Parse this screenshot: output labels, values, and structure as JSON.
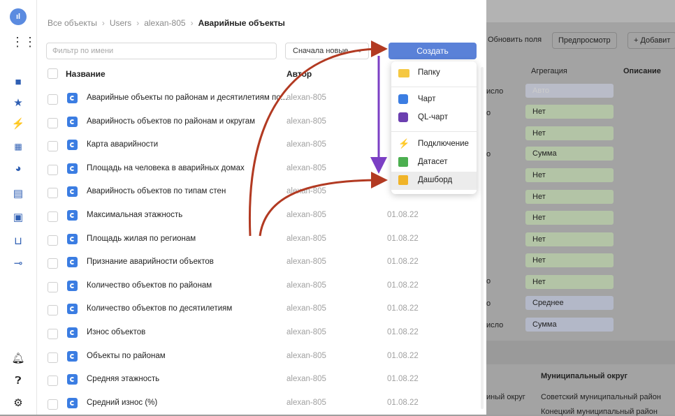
{
  "breadcrumb": {
    "items": [
      "Все объекты",
      "Users",
      "alexan-805"
    ],
    "current": "Аварийные объекты"
  },
  "filter": {
    "placeholder": "Фильтр по имени"
  },
  "sort": {
    "value": "Сначала новые"
  },
  "create_button": {
    "label": "Создать"
  },
  "table": {
    "columns": {
      "name": "Название",
      "author": "Автор"
    },
    "rows": [
      {
        "name": "Аварийные объекты по районам и десятилетиям по...",
        "author": "alexan-805",
        "date": ""
      },
      {
        "name": "Аварийность объектов по районам и округам",
        "author": "alexan-805",
        "date": ""
      },
      {
        "name": "Карта аварийности",
        "author": "alexan-805",
        "date": ""
      },
      {
        "name": "Площадь на человека в аварийных домах",
        "author": "alexan-805",
        "date": ""
      },
      {
        "name": "Аварийность объектов по типам стен",
        "author": "alexan-805",
        "date": ""
      },
      {
        "name": "Максимальная этажность",
        "author": "alexan-805",
        "date": "01.08.22"
      },
      {
        "name": "Площадь жилая по регионам",
        "author": "alexan-805",
        "date": "01.08.22"
      },
      {
        "name": "Признание аварийности объектов",
        "author": "alexan-805",
        "date": "01.08.22"
      },
      {
        "name": "Количество объектов по районам",
        "author": "alexan-805",
        "date": "01.08.22"
      },
      {
        "name": "Количество объектов по десятилетиям",
        "author": "alexan-805",
        "date": "01.08.22"
      },
      {
        "name": "Износ объектов",
        "author": "alexan-805",
        "date": "01.08.22"
      },
      {
        "name": "Объекты по районам",
        "author": "alexan-805",
        "date": "01.08.22"
      },
      {
        "name": "Средняя этажность",
        "author": "alexan-805",
        "date": "01.08.22"
      },
      {
        "name": "Средний износ (%)",
        "author": "alexan-805",
        "date": "01.08.22"
      }
    ]
  },
  "create_menu": {
    "items": [
      {
        "label": "Папку",
        "icon": "folder-icon",
        "color": "#f5c842"
      },
      {
        "label": "Чарт",
        "icon": "chart-icon",
        "color": "#3b7de2"
      },
      {
        "label": "QL-чарт",
        "icon": "ql-chart-icon",
        "color": "#6b3fb0"
      },
      {
        "label": "Подключение",
        "icon": "lightning-icon",
        "color": "#7b4bd6"
      },
      {
        "label": "Датасет",
        "icon": "dataset-icon",
        "color": "#4caf50"
      },
      {
        "label": "Дашборд",
        "icon": "dashboard-icon",
        "color": "#f0b429"
      }
    ]
  },
  "background": {
    "buttons": [
      "Обновить поля",
      "Предпросмотр",
      "+ Добавит"
    ],
    "headers": {
      "aggregation": "Агрегация",
      "description": "Описание"
    },
    "left_fragments": [
      "исло",
      "о",
      "о",
      "о",
      "о",
      "исло"
    ],
    "aggregations": [
      "Авто",
      "Нет",
      "Нет",
      "Сумма",
      "Нет",
      "Нет",
      "Нет",
      "Нет",
      "Нет",
      "Нет",
      "Среднее",
      "Сумма"
    ],
    "preview_header": "Муниципальный округ",
    "preview_left": "иный округ",
    "preview_rows": [
      "Советский муниципальный район",
      "Конецкий муниципальный район"
    ]
  },
  "colors": {
    "accent": "#5a81d8",
    "arrow_red": "#b23a22",
    "arrow_purple": "#7b3fc4"
  }
}
